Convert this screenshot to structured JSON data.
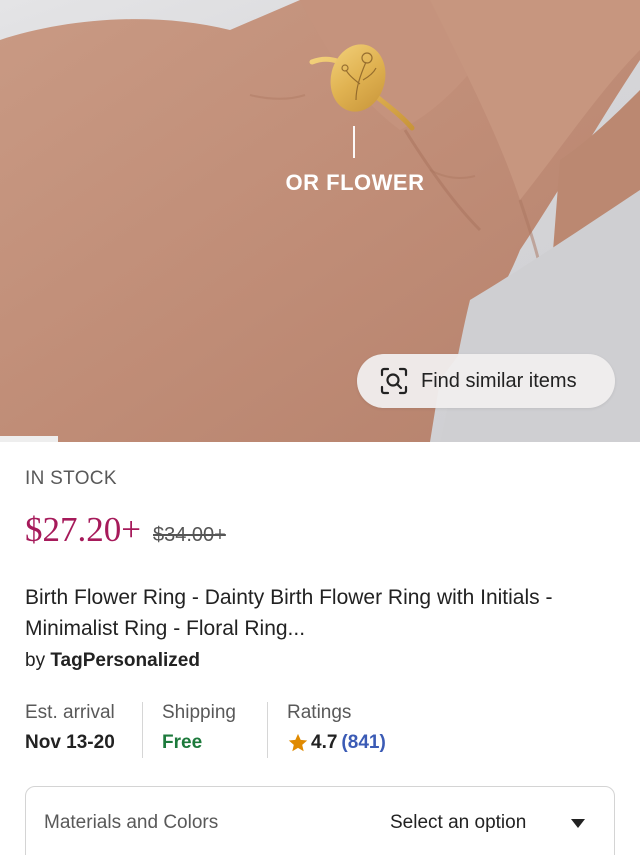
{
  "hero": {
    "caption": "OR FLOWER",
    "find_similar_label": "Find similar items",
    "icons": {
      "find_similar": "scan-search-icon"
    }
  },
  "product": {
    "stock": "IN STOCK",
    "price": "$27.20+",
    "original_price": "$34.00+",
    "title": "Birth Flower Ring - Dainty Birth Flower Ring with Initials -Minimalist Ring - Floral Ring...",
    "seller_prefix": "by",
    "seller": "TagPersonalized"
  },
  "details": {
    "arrival": {
      "label": "Est. arrival",
      "value": "Nov 13-20"
    },
    "shipping": {
      "label": "Shipping",
      "value": "Free"
    },
    "ratings": {
      "label": "Ratings",
      "value": "4.7",
      "count": "(841)"
    }
  },
  "variation": {
    "label": "Materials and Colors",
    "value": "Select an option"
  },
  "colors": {
    "price": "#a61a5a",
    "free_shipping": "#1d7a3c",
    "rating_count": "#3b5bb5",
    "star": "#e08a00"
  }
}
